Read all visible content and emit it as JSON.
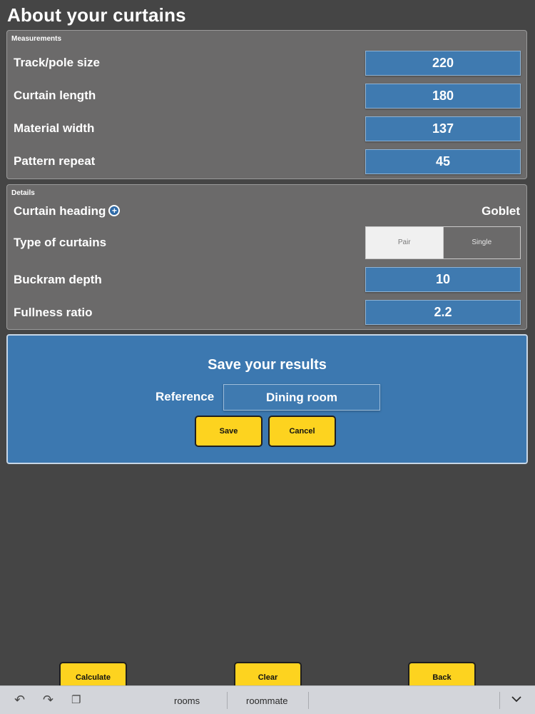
{
  "page": {
    "title": "About your curtains"
  },
  "measurements": {
    "caption": "Measurements",
    "rows": [
      {
        "label": "Track/pole size",
        "value": "220"
      },
      {
        "label": "Curtain length",
        "value": "180"
      },
      {
        "label": "Material width",
        "value": "137"
      },
      {
        "label": "Pattern repeat",
        "value": "45"
      }
    ]
  },
  "details": {
    "caption": "Details",
    "heading_label": "Curtain heading",
    "heading_value": "Goblet",
    "info_icon": "+",
    "type_label": "Type of curtains",
    "type_options": [
      "Pair",
      "Single"
    ],
    "type_selected": "Pair",
    "buckram_label": "Buckram depth",
    "buckram_value": "10",
    "fullness_label": "Fullness ratio",
    "fullness_value": "2.2"
  },
  "save_panel": {
    "title": "Save your results",
    "reference_label": "Reference",
    "reference_value": "Dining room",
    "save_label": "Save",
    "cancel_label": "Cancel"
  },
  "actions": {
    "calculate_label": "Calculate",
    "clear_label": "Clear",
    "back_label": "Back"
  },
  "keyboard_toolbar": {
    "suggestions": [
      "rooms",
      "roommate"
    ],
    "icons": [
      "undo-icon",
      "redo-icon",
      "paste-icon",
      "chevron-down-icon"
    ]
  },
  "colors": {
    "background": "#454545",
    "panel": "#6b6a6a",
    "field_blue": "#3f7ab0",
    "save_panel_blue": "#3c78b0",
    "button_yellow": "#fdd31f"
  }
}
